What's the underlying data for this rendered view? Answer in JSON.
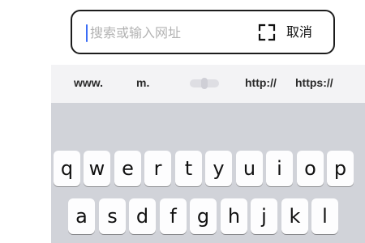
{
  "search": {
    "placeholder": "搜索或输入网址",
    "value": "",
    "scan_icon": "scan-frame-icon",
    "cancel_label": "取消",
    "caret_color": "#3b6df6"
  },
  "quick_bar": {
    "keys": [
      "www.",
      "m.",
      "http://",
      "https://"
    ],
    "cursor_control_icon": "cursor-slider-icon"
  },
  "keyboard": {
    "row1": [
      "q",
      "w",
      "e",
      "r",
      "t",
      "y",
      "u",
      "i",
      "o",
      "p"
    ],
    "row2": [
      "a",
      "s",
      "d",
      "f",
      "g",
      "h",
      "j",
      "k",
      "l"
    ]
  }
}
